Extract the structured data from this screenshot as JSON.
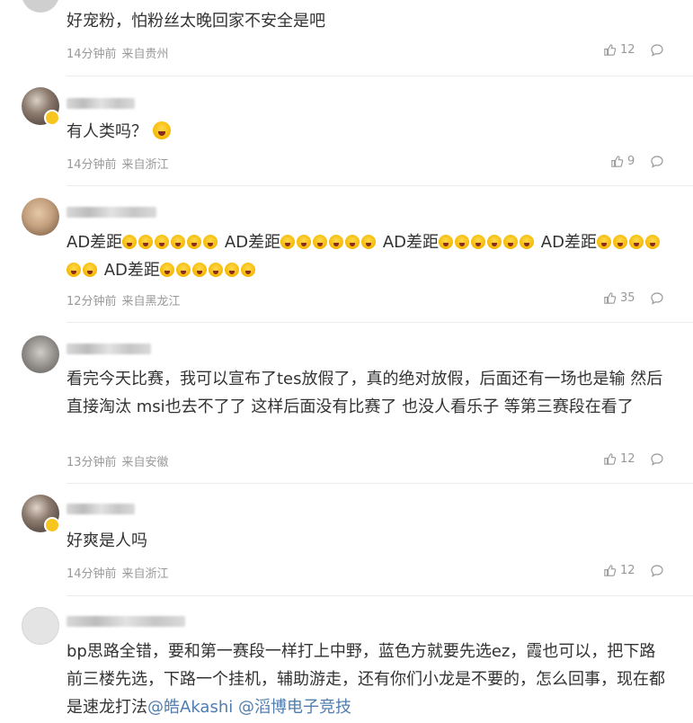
{
  "comments": [
    {
      "text": "好宠粉，怕粉丝太晚回家不安全是吧",
      "time": "14分钟前",
      "location": "来自贵州",
      "likes": "12",
      "avatar_colors": [
        "#c9c9c9",
        "#8a8a8a"
      ]
    },
    {
      "text": "有人类吗？",
      "emoji": "shocked-emoji",
      "time": "14分钟前",
      "location": "来自浙江",
      "likes": "9",
      "avatar_colors": [
        "#5a4a42",
        "#d9cfc4"
      ]
    },
    {
      "segments": [
        "AD差距",
        "AD差距",
        "AD差距",
        "AD差距",
        "AD差距"
      ],
      "emoji": "screaming-emoji",
      "time": "12分钟前",
      "location": "来自黑龙江",
      "likes": "35",
      "avatar_colors": [
        "#c4a07e",
        "#7a5c44"
      ]
    },
    {
      "text": "看完今天比赛，我可以宣布了tes放假了，真的绝对放假，后面还有一场也是输 然后直接淘汰 msi也去不了了 这样后面没有比赛了 也没人看乐子 等第三赛段在看了",
      "time": "13分钟前",
      "location": "来自安徽",
      "likes": "12",
      "avatar_colors": [
        "#8e8a86",
        "#c8c4c0"
      ]
    },
    {
      "text": "好爽是人吗",
      "time": "14分钟前",
      "location": "来自浙江",
      "likes": "12",
      "avatar_colors": [
        "#4a3f3a",
        "#d6c9bf"
      ]
    },
    {
      "text_prefix": "bp思路全错，要和第一赛段一样打上中野，蓝色方就要先选ez，霞也可以，把下路前三楼先选，下路一个挂机，辅助游走，还有你们小龙是不要的，怎么回事，现在都是速龙打法",
      "mentions": [
        "@皓Akashi",
        "@滔博电子竞技"
      ],
      "avatar_colors": [
        "#e6e6e6",
        "#d0d0d0"
      ]
    }
  ],
  "colors": {
    "text": "#333333",
    "meta": "#999999",
    "mention": "#507daf",
    "divider": "#ececec"
  },
  "icons": {
    "like": "thumbs-up-icon",
    "reply": "comment-bubble-icon",
    "badge": "verified-badge-icon"
  }
}
